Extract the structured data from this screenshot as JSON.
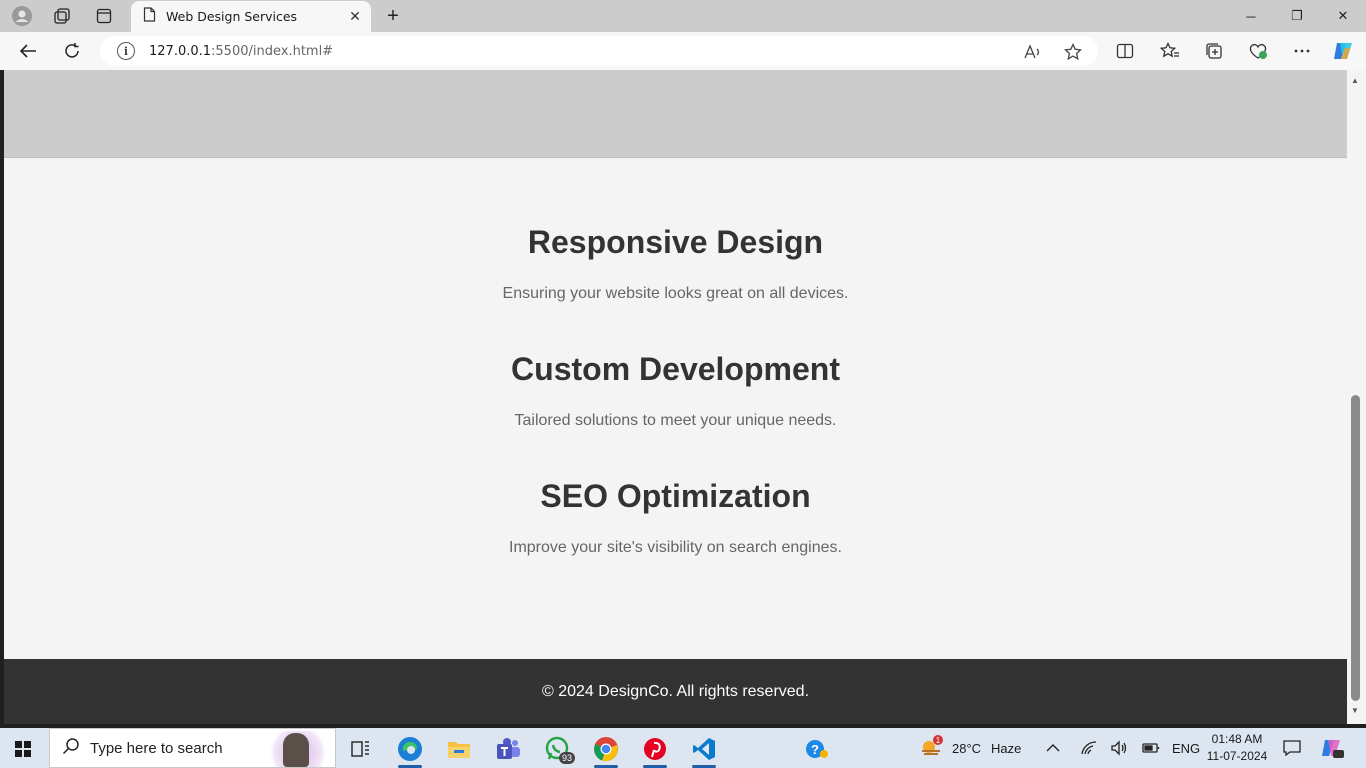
{
  "browser": {
    "tab_title": "Web Design Services",
    "tab_close": "✕",
    "new_tab": "+",
    "url_host": "127.0.0.1",
    "url_path": ":5500/index.html#",
    "window_controls": {
      "minimize": "─",
      "restore": "❐",
      "close": "✕"
    }
  },
  "page": {
    "services": [
      {
        "title": "Responsive Design",
        "description": "Ensuring your website looks great on all devices."
      },
      {
        "title": "Custom Development",
        "description": "Tailored solutions to meet your unique needs."
      },
      {
        "title": "SEO Optimization",
        "description": "Improve your site's visibility on search engines."
      }
    ],
    "footer": "© 2024 DesignCo. All rights reserved."
  },
  "taskbar": {
    "search_placeholder": "Type here to search",
    "whatsapp_badge": "93",
    "weather_temp": "28°C",
    "weather_desc": "Haze",
    "weather_badge": "1",
    "language": "ENG",
    "time": "01:48 AM",
    "date": "11-07-2024"
  },
  "icons": [
    "profile-icon",
    "workspaces-icon",
    "tab-actions-icon",
    "page-icon",
    "back-icon",
    "refresh-icon",
    "info-icon",
    "read-aloud-icon",
    "favorite-star-icon",
    "split-screen-icon",
    "favorites-icon",
    "collections-icon",
    "browser-essentials-icon",
    "more-icon",
    "copilot-icon",
    "windows-start-icon",
    "search-icon",
    "task-view-icon",
    "edge-icon",
    "file-explorer-icon",
    "teams-icon",
    "whatsapp-icon",
    "chrome-icon",
    "pinterest-icon",
    "vscode-icon",
    "help-icon",
    "weather-icon",
    "chevron-up-icon",
    "wifi-icon",
    "volume-icon",
    "battery-icon",
    "notification-icon"
  ]
}
